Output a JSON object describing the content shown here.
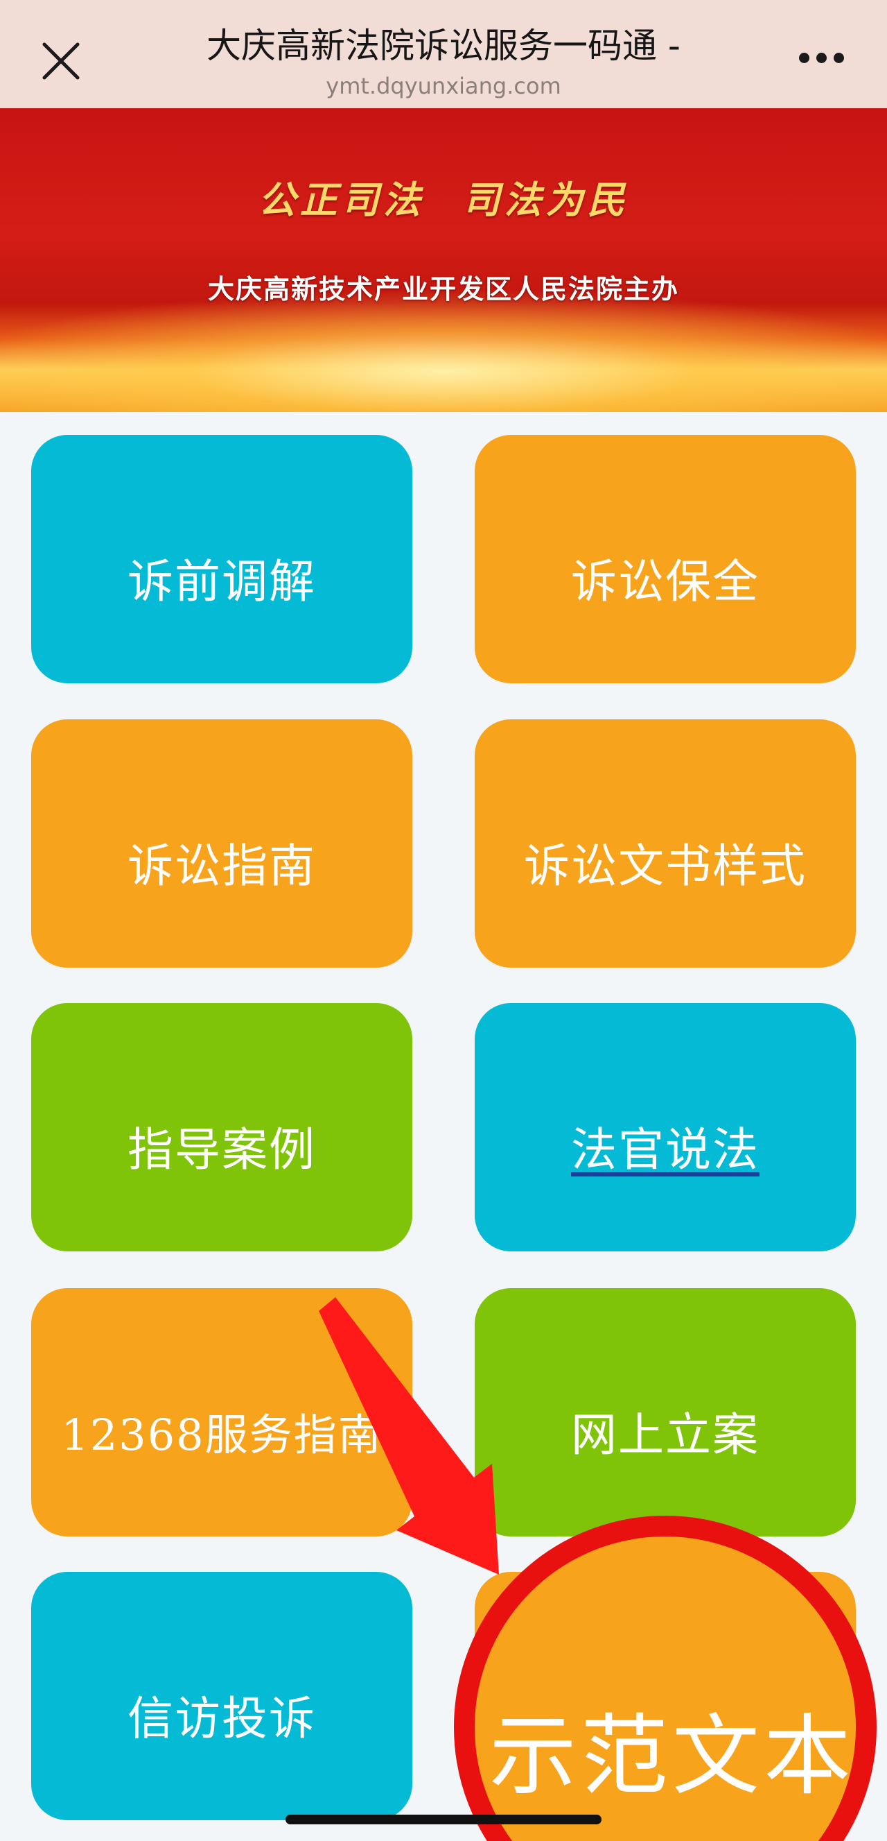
{
  "nav": {
    "title": "大庆高新法院诉讼服务一码通 -",
    "url": "ymt.dqyunxiang.com"
  },
  "banner": {
    "slogan": "公正司法 司法为民",
    "organizer": "大庆高新技术产业开发区人民法院主办"
  },
  "tiles": [
    {
      "label": "诉前调解",
      "color": "#05bad4"
    },
    {
      "label": "诉讼保全",
      "color": "#f7a41c"
    },
    {
      "label": "诉讼指南",
      "color": "#f7a41c"
    },
    {
      "label": "诉讼文书样式",
      "color": "#f7a41c"
    },
    {
      "label": "指导案例",
      "color": "#80c40a"
    },
    {
      "label": "法官说法",
      "color": "#05bad4"
    },
    {
      "label": "12368服务指南",
      "color": "#f7a41c"
    },
    {
      "label": "网上立案",
      "color": "#80c40a"
    },
    {
      "label": "信访投诉",
      "color": "#05bad4"
    },
    {
      "label": "示范文本",
      "color": "#f7a41c"
    }
  ],
  "annotation": {
    "arrow_color": "#ff1a1a",
    "highlight_text": "示范文本"
  },
  "icons": [
    "close-icon",
    "more-icon"
  ]
}
